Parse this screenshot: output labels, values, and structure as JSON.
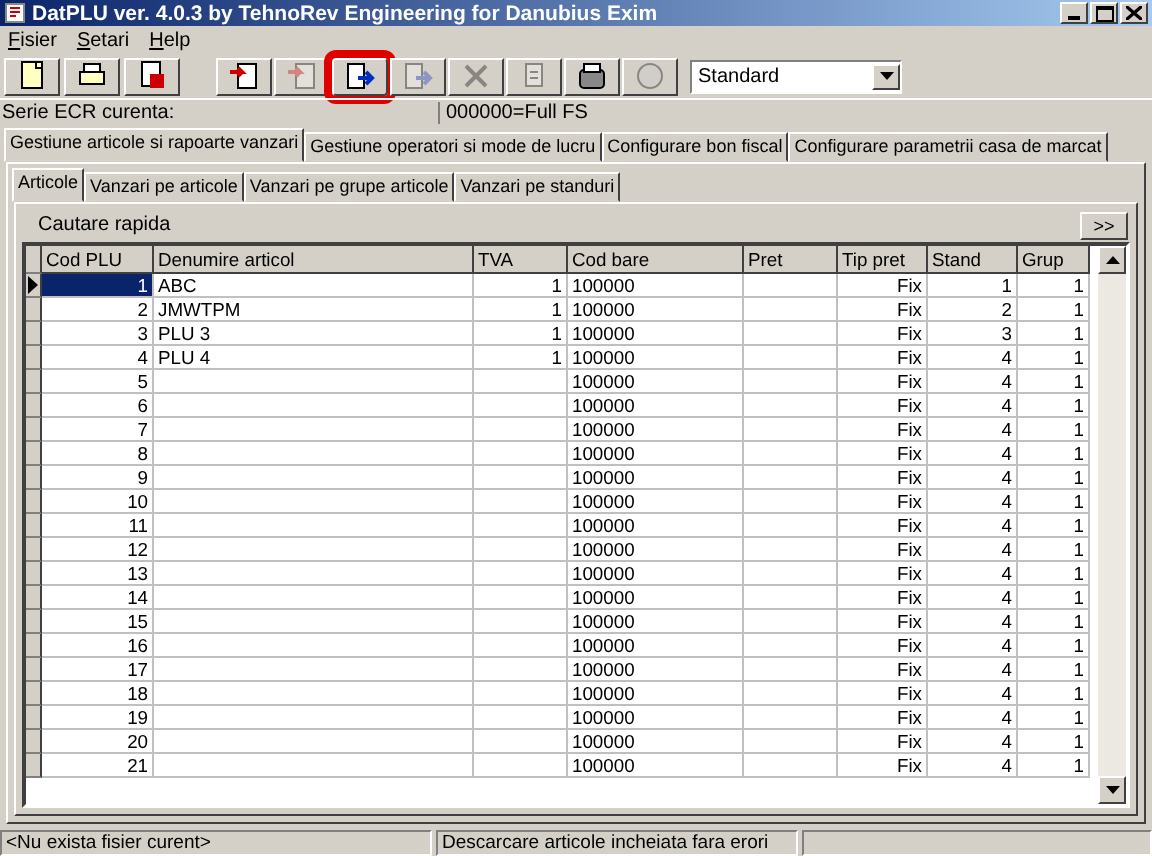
{
  "window": {
    "title": "DatPLU ver. 4.0.3 by TehnoRev Engineering for Danubius Exim"
  },
  "menu": [
    "Fisier",
    "Setari",
    "Help"
  ],
  "toolbar": {
    "groups": [
      [
        {
          "kind": "new",
          "disabled": false,
          "highlighted": false
        },
        {
          "kind": "open",
          "disabled": false,
          "highlighted": false
        },
        {
          "kind": "save",
          "disabled": false,
          "highlighted": false
        }
      ],
      [
        {
          "kind": "import",
          "disabled": false,
          "highlighted": false
        },
        {
          "kind": "import",
          "disabled": true,
          "highlighted": false
        },
        {
          "kind": "export",
          "disabled": false,
          "highlighted": true
        },
        {
          "kind": "export",
          "disabled": true,
          "highlighted": false
        },
        {
          "kind": "delete",
          "disabled": true,
          "highlighted": false
        },
        {
          "kind": "page",
          "disabled": true,
          "highlighted": false
        },
        {
          "kind": "register",
          "disabled": false,
          "highlighted": false
        },
        {
          "kind": "circle",
          "disabled": true,
          "highlighted": false
        }
      ]
    ],
    "dropdown": {
      "value": "Standard"
    }
  },
  "info": {
    "label": "Serie ECR curenta:",
    "value": "000000=Full FS"
  },
  "tabs": [
    {
      "label": "Gestiune articole si rapoarte vanzari",
      "selected": true
    },
    {
      "label": "Gestiune operatori si mode de lucru",
      "selected": false
    },
    {
      "label": "Configurare bon fiscal",
      "selected": false
    },
    {
      "label": "Configurare parametrii casa de marcat",
      "selected": false
    }
  ],
  "subtabs": [
    {
      "label": "Articole",
      "selected": true
    },
    {
      "label": "Vanzari pe articole",
      "selected": false
    },
    {
      "label": "Vanzari pe grupe articole",
      "selected": false
    },
    {
      "label": "Vanzari pe standuri",
      "selected": false
    }
  ],
  "search": {
    "label": "Cautare rapida",
    "button": ">>"
  },
  "table": {
    "columns": [
      "Cod PLU",
      "Denumire articol",
      "TVA",
      "Cod bare",
      "Pret",
      "Tip pret",
      "Stand",
      "Grup"
    ],
    "rows": [
      {
        "selected": true,
        "cells": [
          "1",
          "ABC",
          "1",
          "100000",
          "",
          "Fix",
          "1",
          "1"
        ]
      },
      {
        "selected": false,
        "cells": [
          "2",
          "JMWTPM",
          "1",
          "100000",
          "",
          "Fix",
          "2",
          "1"
        ]
      },
      {
        "selected": false,
        "cells": [
          "3",
          "PLU 3",
          "1",
          "100000",
          "",
          "Fix",
          "3",
          "1"
        ]
      },
      {
        "selected": false,
        "cells": [
          "4",
          "PLU 4",
          "1",
          "100000",
          "",
          "Fix",
          "4",
          "1"
        ]
      },
      {
        "selected": false,
        "cells": [
          "5",
          "",
          "",
          "100000",
          "",
          "Fix",
          "4",
          "1"
        ]
      },
      {
        "selected": false,
        "cells": [
          "6",
          "",
          "",
          "100000",
          "",
          "Fix",
          "4",
          "1"
        ]
      },
      {
        "selected": false,
        "cells": [
          "7",
          "",
          "",
          "100000",
          "",
          "Fix",
          "4",
          "1"
        ]
      },
      {
        "selected": false,
        "cells": [
          "8",
          "",
          "",
          "100000",
          "",
          "Fix",
          "4",
          "1"
        ]
      },
      {
        "selected": false,
        "cells": [
          "9",
          "",
          "",
          "100000",
          "",
          "Fix",
          "4",
          "1"
        ]
      },
      {
        "selected": false,
        "cells": [
          "10",
          "",
          "",
          "100000",
          "",
          "Fix",
          "4",
          "1"
        ]
      },
      {
        "selected": false,
        "cells": [
          "11",
          "",
          "",
          "100000",
          "",
          "Fix",
          "4",
          "1"
        ]
      },
      {
        "selected": false,
        "cells": [
          "12",
          "",
          "",
          "100000",
          "",
          "Fix",
          "4",
          "1"
        ]
      },
      {
        "selected": false,
        "cells": [
          "13",
          "",
          "",
          "100000",
          "",
          "Fix",
          "4",
          "1"
        ]
      },
      {
        "selected": false,
        "cells": [
          "14",
          "",
          "",
          "100000",
          "",
          "Fix",
          "4",
          "1"
        ]
      },
      {
        "selected": false,
        "cells": [
          "15",
          "",
          "",
          "100000",
          "",
          "Fix",
          "4",
          "1"
        ]
      },
      {
        "selected": false,
        "cells": [
          "16",
          "",
          "",
          "100000",
          "",
          "Fix",
          "4",
          "1"
        ]
      },
      {
        "selected": false,
        "cells": [
          "17",
          "",
          "",
          "100000",
          "",
          "Fix",
          "4",
          "1"
        ]
      },
      {
        "selected": false,
        "cells": [
          "18",
          "",
          "",
          "100000",
          "",
          "Fix",
          "4",
          "1"
        ]
      },
      {
        "selected": false,
        "cells": [
          "19",
          "",
          "",
          "100000",
          "",
          "Fix",
          "4",
          "1"
        ]
      },
      {
        "selected": false,
        "cells": [
          "20",
          "",
          "",
          "100000",
          "",
          "Fix",
          "4",
          "1"
        ]
      },
      {
        "selected": false,
        "cells": [
          "21",
          "",
          "",
          "100000",
          "",
          "Fix",
          "4",
          "1"
        ]
      }
    ]
  },
  "status_bar": [
    "<Nu exista fisier curent>",
    "Descarcare articole incheiata fara erori"
  ]
}
